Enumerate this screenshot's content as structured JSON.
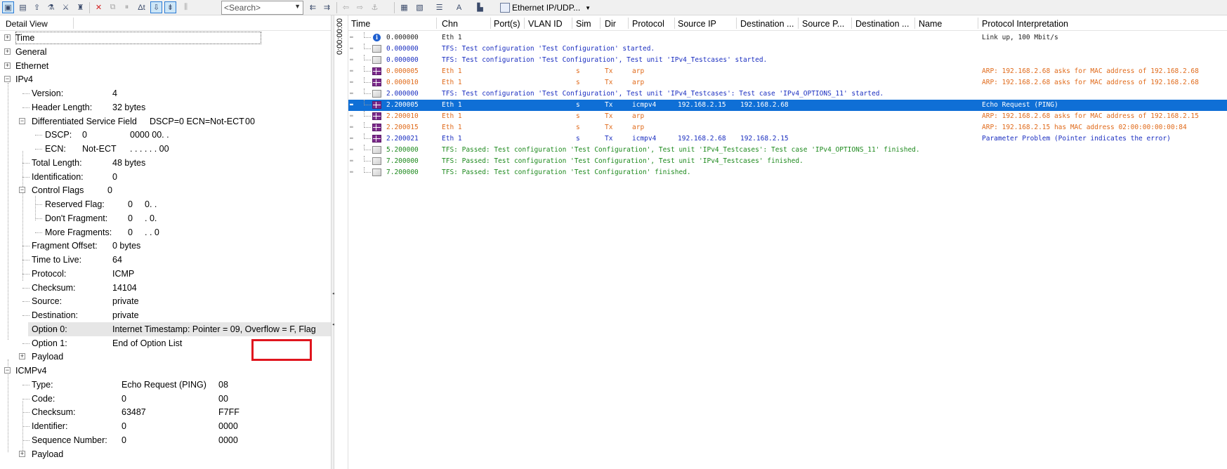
{
  "toolbar": {
    "search_placeholder": "<Search>",
    "protocol_filter": "Ethernet IP/UDP..."
  },
  "detail": {
    "title": "Detail View",
    "rows": [
      {
        "label": "Time"
      },
      {
        "label": "General"
      },
      {
        "label": "Ethernet"
      },
      {
        "label": "IPv4"
      },
      {
        "label": "Version:",
        "value": "4"
      },
      {
        "label": "Header Length:",
        "value": "32 bytes"
      },
      {
        "label": "Differentiated Service Field",
        "value": "DSCP=0 ECN=Not-ECT",
        "hex": "00"
      },
      {
        "label": "DSCP:",
        "value": "0",
        "hex": "0000 00. ."
      },
      {
        "label": "ECN:",
        "value": "Not-ECT",
        "hex": ". . . . . . 00"
      },
      {
        "label": "Total Length:",
        "value": "48 bytes"
      },
      {
        "label": "Identification:",
        "value": "0"
      },
      {
        "label": "Control Flags",
        "value": "0"
      },
      {
        "label": "Reserved Flag:",
        "value": "0",
        "hex": "0. ."
      },
      {
        "label": "Don't Fragment:",
        "value": "0",
        "hex": ". 0."
      },
      {
        "label": "More Fragments:",
        "value": "0",
        "hex": ". . 0"
      },
      {
        "label": "Fragment Offset:",
        "value": "0 bytes"
      },
      {
        "label": "Time to Live:",
        "value": "64"
      },
      {
        "label": "Protocol:",
        "value": "ICMP"
      },
      {
        "label": "Checksum:",
        "value": "14104"
      },
      {
        "label": "Source:",
        "value": "private"
      },
      {
        "label": "Destination:",
        "value": "private"
      },
      {
        "label": "Option 0:",
        "value": "Internet Timestamp: Pointer = 09, Overflow = F, Flag"
      },
      {
        "label": "Option 1:",
        "value": "End of Option List"
      },
      {
        "label": "Payload"
      },
      {
        "label": "ICMPv4"
      },
      {
        "label": "Type:",
        "value": "Echo Request (PING)",
        "hex": "08"
      },
      {
        "label": "Code:",
        "value": "0",
        "hex": "00"
      },
      {
        "label": "Checksum:",
        "value": "63487",
        "hex": "F7FF"
      },
      {
        "label": "Identifier:",
        "value": "0",
        "hex": "0000"
      },
      {
        "label": "Sequence Number:",
        "value": "0",
        "hex": "0000"
      },
      {
        "label": "Payload"
      }
    ]
  },
  "vertical_time": "0:00:00:00",
  "trace": {
    "columns": [
      "Time",
      "Chn",
      "Port(s)",
      "VLAN ID",
      "Sim",
      "Dir",
      "Protocol",
      "Source IP",
      "Destination ...",
      "Source P...",
      "Destination ...",
      "Name",
      "Protocol Interpretation"
    ],
    "rows": [
      {
        "icon": "info",
        "time": "0.000000",
        "chn": "Eth 1",
        "sim": "",
        "dir": "",
        "protocol": "",
        "src": "",
        "dst": "",
        "interp": "Link up, 100 Mbit/s",
        "color": "black"
      },
      {
        "icon": "mail",
        "time": "0.000000",
        "chn": "TFS: Test configuration 'Test Configuration' started.",
        "sim": "",
        "dir": "",
        "protocol": "",
        "src": "",
        "dst": "",
        "interp": "",
        "color": "blue"
      },
      {
        "icon": "mail",
        "time": "0.000000",
        "chn": "TFS: Test configuration 'Test Configuration', Test unit 'IPv4_Testcases' started.",
        "sim": "",
        "dir": "",
        "protocol": "",
        "src": "",
        "dst": "",
        "interp": "",
        "color": "blue"
      },
      {
        "icon": "frame",
        "time": "0.000005",
        "chn": "Eth 1",
        "sim": "s",
        "dir": "Tx",
        "protocol": "arp",
        "src": "",
        "dst": "",
        "interp": "ARP: 192.168.2.68 asks for MAC address of 192.168.2.68",
        "color": "orange"
      },
      {
        "icon": "frame",
        "time": "0.000010",
        "chn": "Eth 1",
        "sim": "s",
        "dir": "Tx",
        "protocol": "arp",
        "src": "",
        "dst": "",
        "interp": "ARP: 192.168.2.68 asks for MAC address of 192.168.2.68",
        "color": "orange"
      },
      {
        "icon": "mail",
        "time": "2.000000",
        "chn": "TFS: Test configuration 'Test Configuration', Test unit 'IPv4_Testcases': Test case 'IPv4_OPTIONS_11' started.",
        "sim": "",
        "dir": "",
        "protocol": "",
        "src": "",
        "dst": "",
        "interp": "",
        "color": "blue"
      },
      {
        "icon": "frame",
        "time": "2.200005",
        "chn": "Eth 1",
        "sim": "s",
        "dir": "Tx",
        "protocol": "icmpv4",
        "src": "192.168.2.15",
        "dst": "192.168.2.68",
        "interp": "Echo Request (PING)",
        "color": "selected"
      },
      {
        "icon": "frame",
        "time": "2.200010",
        "chn": "Eth 1",
        "sim": "s",
        "dir": "Tx",
        "protocol": "arp",
        "src": "",
        "dst": "",
        "interp": "ARP: 192.168.2.68 asks for MAC address of 192.168.2.15",
        "color": "orange"
      },
      {
        "icon": "frame",
        "time": "2.200015",
        "chn": "Eth 1",
        "sim": "s",
        "dir": "Tx",
        "protocol": "arp",
        "src": "",
        "dst": "",
        "interp": "ARP: 192.168.2.15 has MAC address 02:00:00:00:00:84",
        "color": "orange"
      },
      {
        "icon": "frame",
        "time": "2.200021",
        "chn": "Eth 1",
        "sim": "s",
        "dir": "Tx",
        "protocol": "icmpv4",
        "src": "192.168.2.68",
        "dst": "192.168.2.15",
        "interp": "Parameter Problem (Pointer indicates the error)",
        "color": "blue"
      },
      {
        "icon": "mail",
        "time": "5.200000",
        "chn": "TFS: Passed: Test configuration 'Test Configuration', Test unit 'IPv4_Testcases': Test case 'IPv4_OPTIONS_11' finished.",
        "sim": "",
        "dir": "",
        "protocol": "",
        "src": "",
        "dst": "",
        "interp": "",
        "color": "green"
      },
      {
        "icon": "mail",
        "time": "7.200000",
        "chn": "TFS: Passed: Test configuration 'Test Configuration', Test unit 'IPv4_Testcases' finished.",
        "sim": "",
        "dir": "",
        "protocol": "",
        "src": "",
        "dst": "",
        "interp": "",
        "color": "green"
      },
      {
        "icon": "mail",
        "time": "7.200000",
        "chn": "TFS: Passed: Test configuration 'Test Configuration' finished.",
        "sim": "",
        "dir": "",
        "protocol": "",
        "src": "",
        "dst": "",
        "interp": "",
        "color": "green"
      }
    ]
  }
}
